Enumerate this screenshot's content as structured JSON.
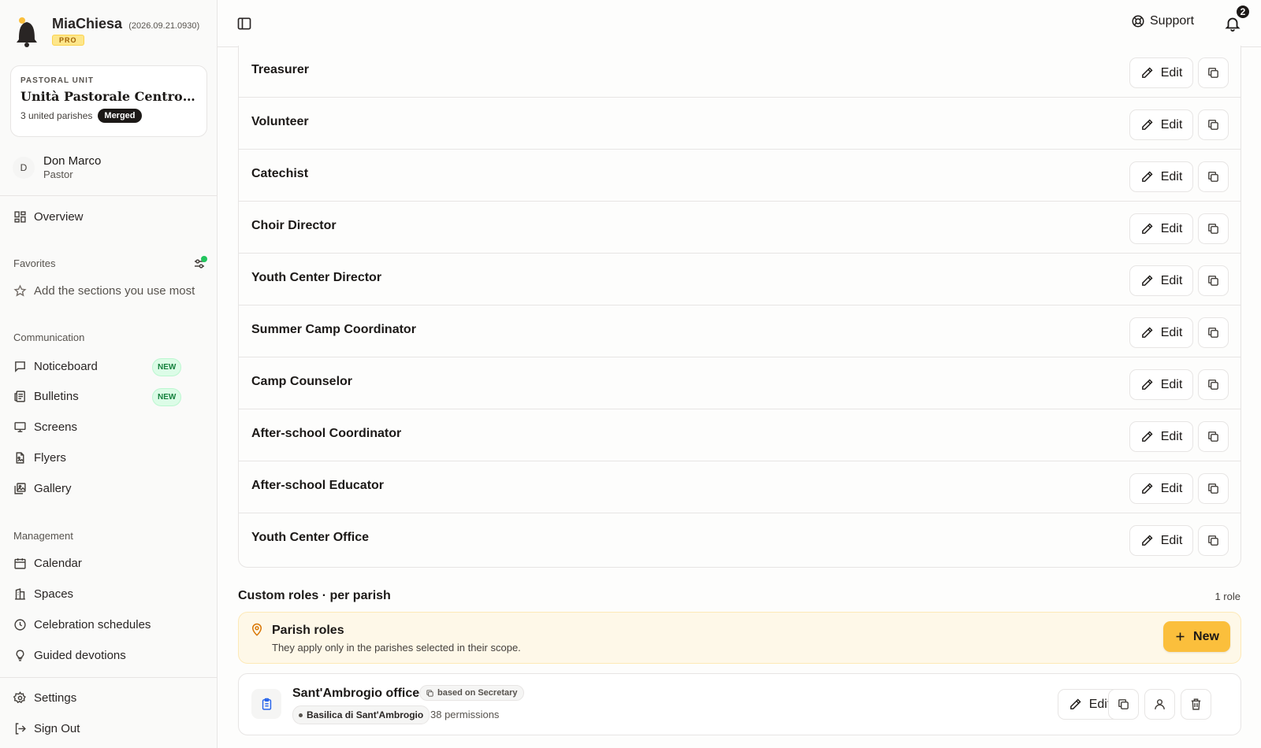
{
  "brand": {
    "name": "MiaChiesa",
    "version": "(2026.09.21.0930)",
    "plan": "PRO"
  },
  "pastoral_unit": {
    "eyebrow": "PASTORAL UNIT",
    "name": "Unità Pastorale Centro Storico",
    "parishes": "3 united parishes",
    "badge": "Merged"
  },
  "user": {
    "initial": "D",
    "name": "Don Marco",
    "role": "Pastor"
  },
  "sidebar": {
    "overview": "Overview",
    "favorites_label": "Favorites",
    "favorites_empty": "Add the sections you use most",
    "communication_label": "Communication",
    "communication": [
      {
        "label": "Noticeboard",
        "badge": "NEW"
      },
      {
        "label": "Bulletins",
        "badge": "NEW"
      },
      {
        "label": "Screens"
      },
      {
        "label": "Flyers"
      },
      {
        "label": "Gallery"
      }
    ],
    "management_label": "Management",
    "management": [
      {
        "label": "Calendar"
      },
      {
        "label": "Spaces"
      },
      {
        "label": "Celebration schedules"
      },
      {
        "label": "Guided devotions"
      }
    ],
    "settings": "Settings",
    "sign_out": "Sign Out"
  },
  "header": {
    "support": "Support",
    "notifications": "2"
  },
  "roles": [
    {
      "name": "Treasurer",
      "edit": "Edit"
    },
    {
      "name": "Volunteer",
      "edit": "Edit"
    },
    {
      "name": "Catechist",
      "edit": "Edit"
    },
    {
      "name": "Choir Director",
      "edit": "Edit"
    },
    {
      "name": "Youth Center Director",
      "edit": "Edit"
    },
    {
      "name": "Summer Camp Coordinator",
      "edit": "Edit"
    },
    {
      "name": "Camp Counselor",
      "edit": "Edit"
    },
    {
      "name": "After-school Coordinator",
      "edit": "Edit"
    },
    {
      "name": "After-school Educator",
      "edit": "Edit"
    },
    {
      "name": "Youth Center Office",
      "edit": "Edit"
    }
  ],
  "custom_roles": {
    "heading": "Custom roles · per parish",
    "count": "1 role",
    "banner_title": "Parish roles",
    "banner_subtitle": "They apply only in the parishes selected in their scope.",
    "new_label": "New",
    "items": [
      {
        "name": "Sant'Ambrogio office",
        "based_on": "based on Secretary",
        "parish": "Basilica di Sant'Ambrogio",
        "permissions": "38 permissions",
        "edit": "Edit"
      }
    ]
  },
  "colors": {
    "accent": "#fbbf3c",
    "new_badge": "#15803d",
    "banner_bg": "#fef8e8"
  }
}
